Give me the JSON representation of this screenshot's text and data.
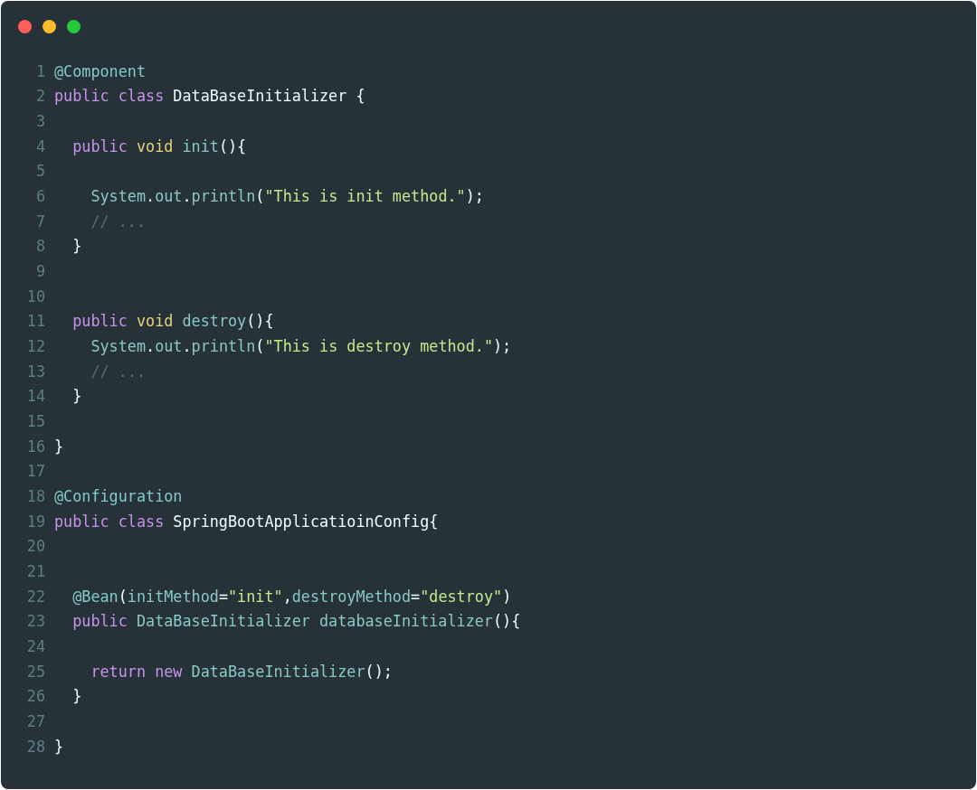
{
  "window_buttons": [
    {
      "color": "#ff5f56"
    },
    {
      "color": "#ffbd2e"
    },
    {
      "color": "#27c93f"
    }
  ],
  "code_lines": [
    {
      "number": "1",
      "tokens": [
        {
          "kind": "annotation",
          "text": "@Component"
        }
      ]
    },
    {
      "number": "2",
      "tokens": [
        {
          "kind": "keyword",
          "text": "public class "
        },
        {
          "kind": "plain",
          "text": "DataBaseInitializer {"
        }
      ]
    },
    {
      "number": "3"
    },
    {
      "number": "4",
      "tokens": [
        {
          "kind": "keyword",
          "text": "  public "
        },
        {
          "kind": "type",
          "text": "void "
        },
        {
          "kind": "ident",
          "text": "init"
        },
        {
          "kind": "plain",
          "text": "(){"
        }
      ]
    },
    {
      "number": "5"
    },
    {
      "number": "6",
      "tokens": [
        {
          "kind": "ident",
          "text": "    System"
        },
        {
          "kind": "plain",
          "text": "."
        },
        {
          "kind": "ident",
          "text": "out"
        },
        {
          "kind": "plain",
          "text": "."
        },
        {
          "kind": "ident",
          "text": "println"
        },
        {
          "kind": "plain",
          "text": "("
        },
        {
          "kind": "string",
          "text": "\"This is init method.\""
        },
        {
          "kind": "plain",
          "text": ");"
        }
      ]
    },
    {
      "number": "7",
      "tokens": [
        {
          "kind": "comment",
          "text": "    // ..."
        }
      ]
    },
    {
      "number": "8",
      "tokens": [
        {
          "kind": "plain",
          "text": "  }"
        }
      ]
    },
    {
      "number": "9"
    },
    {
      "number": "10"
    },
    {
      "number": "11",
      "tokens": [
        {
          "kind": "keyword",
          "text": "  public "
        },
        {
          "kind": "type",
          "text": "void "
        },
        {
          "kind": "ident",
          "text": "destroy"
        },
        {
          "kind": "plain",
          "text": "(){"
        }
      ]
    },
    {
      "number": "12",
      "tokens": [
        {
          "kind": "ident",
          "text": "    System"
        },
        {
          "kind": "plain",
          "text": "."
        },
        {
          "kind": "ident",
          "text": "out"
        },
        {
          "kind": "plain",
          "text": "."
        },
        {
          "kind": "ident",
          "text": "println"
        },
        {
          "kind": "plain",
          "text": "("
        },
        {
          "kind": "string",
          "text": "\"This is destroy method.\""
        },
        {
          "kind": "plain",
          "text": ");"
        }
      ]
    },
    {
      "number": "13",
      "tokens": [
        {
          "kind": "comment",
          "text": "    // ..."
        }
      ]
    },
    {
      "number": "14",
      "tokens": [
        {
          "kind": "plain",
          "text": "  }"
        }
      ]
    },
    {
      "number": "15"
    },
    {
      "number": "16",
      "tokens": [
        {
          "kind": "plain",
          "text": "}"
        }
      ]
    },
    {
      "number": "17"
    },
    {
      "number": "18",
      "tokens": [
        {
          "kind": "annotation",
          "text": "@Configuration"
        }
      ]
    },
    {
      "number": "19",
      "tokens": [
        {
          "kind": "keyword",
          "text": "public class "
        },
        {
          "kind": "plain",
          "text": "SpringBootApplicatioinConfig{"
        }
      ]
    },
    {
      "number": "20"
    },
    {
      "number": "21"
    },
    {
      "number": "22",
      "tokens": [
        {
          "kind": "annotation",
          "text": "  @Bean"
        },
        {
          "kind": "plain",
          "text": "("
        },
        {
          "kind": "ident",
          "text": "initMethod"
        },
        {
          "kind": "plain",
          "text": "="
        },
        {
          "kind": "string",
          "text": "\"init\""
        },
        {
          "kind": "plain",
          "text": ","
        },
        {
          "kind": "ident",
          "text": "destroyMethod"
        },
        {
          "kind": "plain",
          "text": "="
        },
        {
          "kind": "string",
          "text": "\"destroy\""
        },
        {
          "kind": "plain",
          "text": ")"
        }
      ]
    },
    {
      "number": "23",
      "tokens": [
        {
          "kind": "keyword",
          "text": "  public "
        },
        {
          "kind": "ident",
          "text": "DataBaseInitializer databaseInitializer"
        },
        {
          "kind": "plain",
          "text": "(){"
        }
      ]
    },
    {
      "number": "24"
    },
    {
      "number": "25",
      "tokens": [
        {
          "kind": "keyword",
          "text": "    return new "
        },
        {
          "kind": "ident",
          "text": "DataBaseInitializer"
        },
        {
          "kind": "plain",
          "text": "();"
        }
      ]
    },
    {
      "number": "26",
      "tokens": [
        {
          "kind": "plain",
          "text": "  }"
        }
      ]
    },
    {
      "number": "27"
    },
    {
      "number": "28",
      "tokens": [
        {
          "kind": "plain",
          "text": "}"
        }
      ]
    }
  ]
}
